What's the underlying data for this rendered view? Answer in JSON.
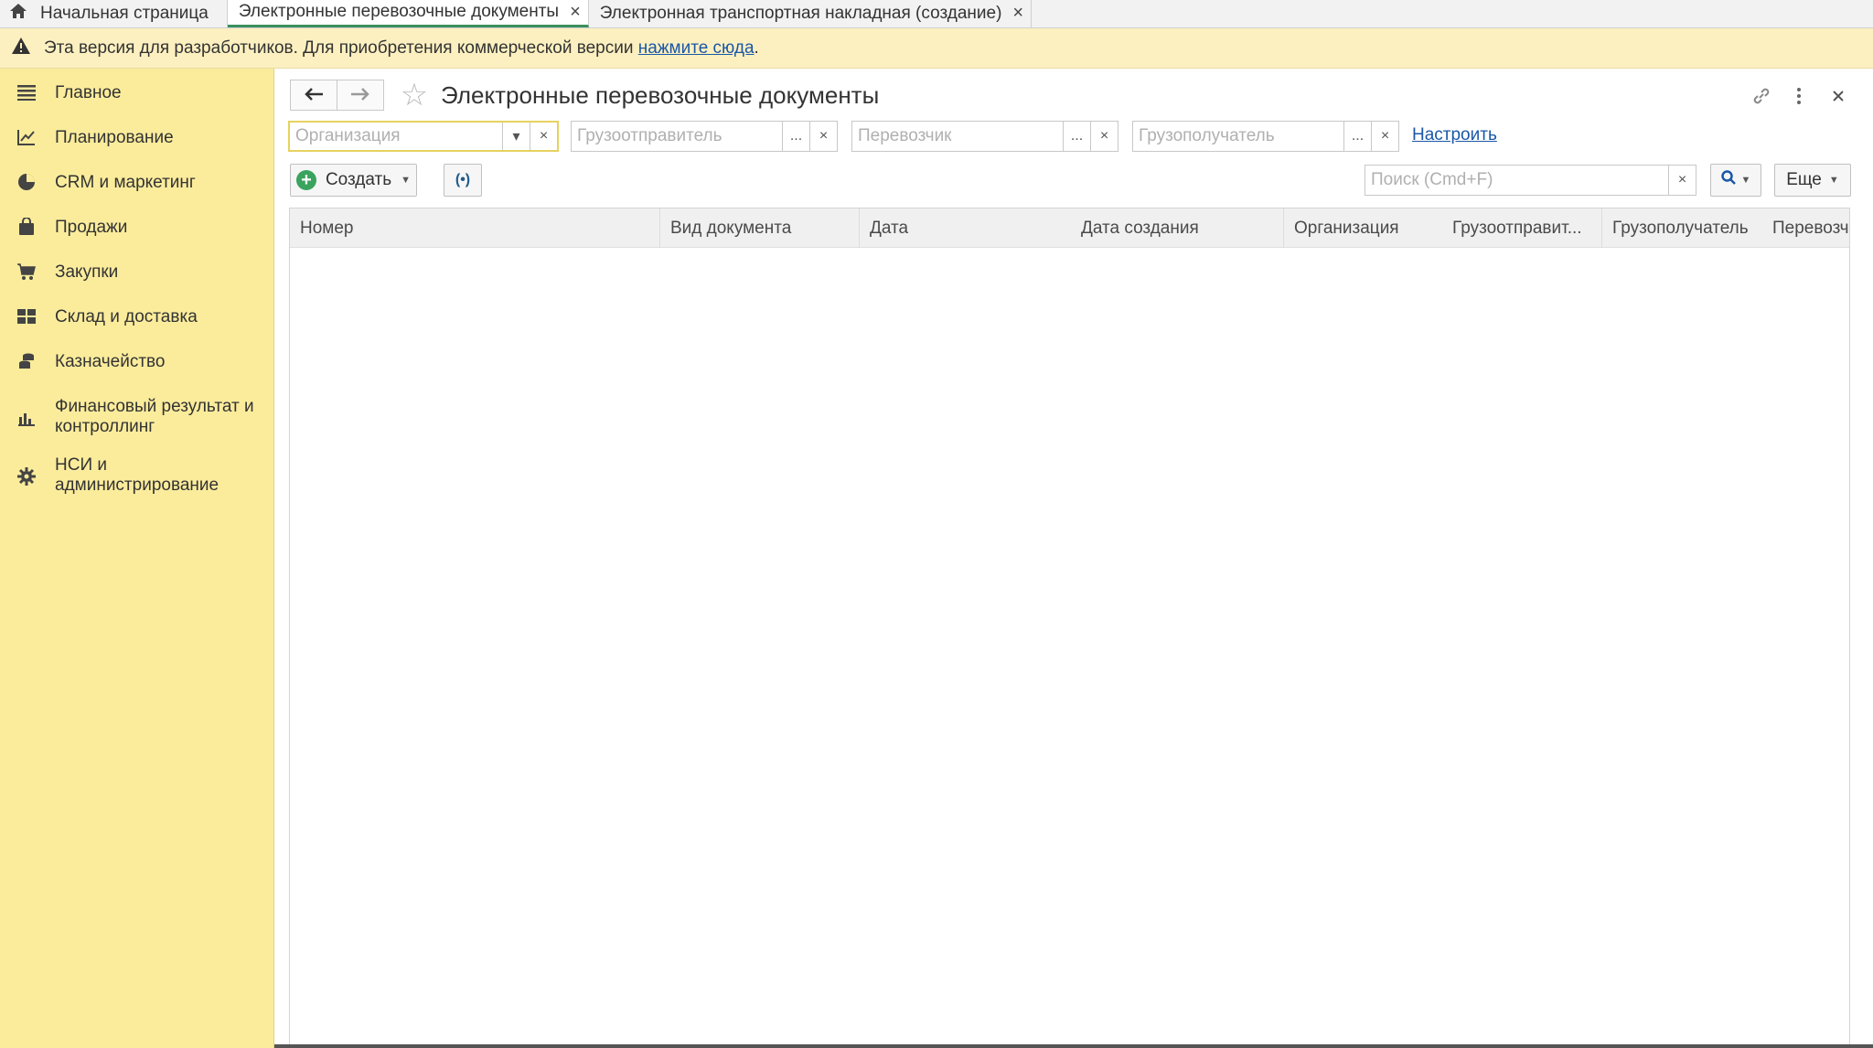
{
  "tabs": {
    "home": "Начальная страница",
    "items": [
      {
        "label": "Электронные перевозочные документы",
        "active": true
      },
      {
        "label": "Электронная транспортная накладная (создание)",
        "active": false
      }
    ],
    "close": "×"
  },
  "banner": {
    "text": "Эта версия для разработчиков. Для приобретения коммерческой версии ",
    "link": "нажмите сюда",
    "tail": "."
  },
  "sidebar": {
    "items": [
      {
        "label": "Главное",
        "icon": "menu-icon"
      },
      {
        "label": "Планирование",
        "icon": "planning-icon"
      },
      {
        "label": "CRM и маркетинг",
        "icon": "pie-chart-icon"
      },
      {
        "label": "Продажи",
        "icon": "shopping-bag-icon"
      },
      {
        "label": "Закупки",
        "icon": "cart-icon"
      },
      {
        "label": "Склад и доставка",
        "icon": "warehouse-icon"
      },
      {
        "label": "Казначейство",
        "icon": "coins-icon"
      },
      {
        "label": "Финансовый результат и контроллинг",
        "icon": "bar-chart-icon"
      },
      {
        "label": "НСИ и администрирование",
        "icon": "gear-icon"
      }
    ]
  },
  "page": {
    "title": "Электронные перевозочные документы"
  },
  "filters": {
    "organization_placeholder": "Организация",
    "shipper_placeholder": "Грузоотправитель",
    "carrier_placeholder": "Перевозчик",
    "consignee_placeholder": "Грузополучатель",
    "setup_link": "Настроить",
    "dots": "...",
    "clear": "×"
  },
  "toolbar": {
    "create_label": "Создать",
    "exchange_label": "(•)",
    "search_placeholder": "Поиск (Cmd+F)",
    "more_label": "Еще"
  },
  "table": {
    "columns": [
      "Номер",
      "Вид документа",
      "Дата",
      "Дата создания",
      "Организация",
      "Грузоотправит...",
      "Грузополучатель",
      "Перевозч"
    ],
    "rows": []
  }
}
